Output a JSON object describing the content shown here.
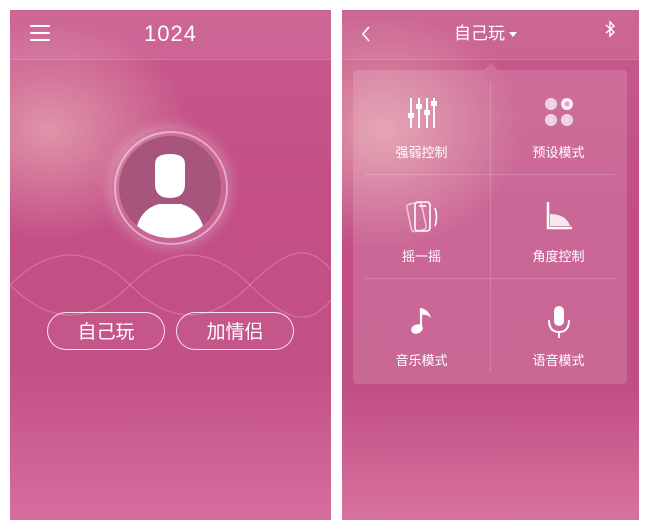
{
  "left_screen": {
    "title": "1024",
    "buttons": {
      "play_alone": "自己玩",
      "add_partner": "加情侣"
    }
  },
  "right_screen": {
    "title": "自己玩",
    "modes": [
      {
        "label": "强弱控制",
        "icon": "sliders-icon"
      },
      {
        "label": "预设模式",
        "icon": "preset-dots-icon"
      },
      {
        "label": "摇一摇",
        "icon": "shake-phone-icon"
      },
      {
        "label": "角度控制",
        "icon": "angle-icon"
      },
      {
        "label": "音乐模式",
        "icon": "music-note-icon"
      },
      {
        "label": "语音模式",
        "icon": "microphone-icon"
      }
    ]
  },
  "colors": {
    "primary_pink": "#c34f86",
    "text": "#ffffff"
  }
}
